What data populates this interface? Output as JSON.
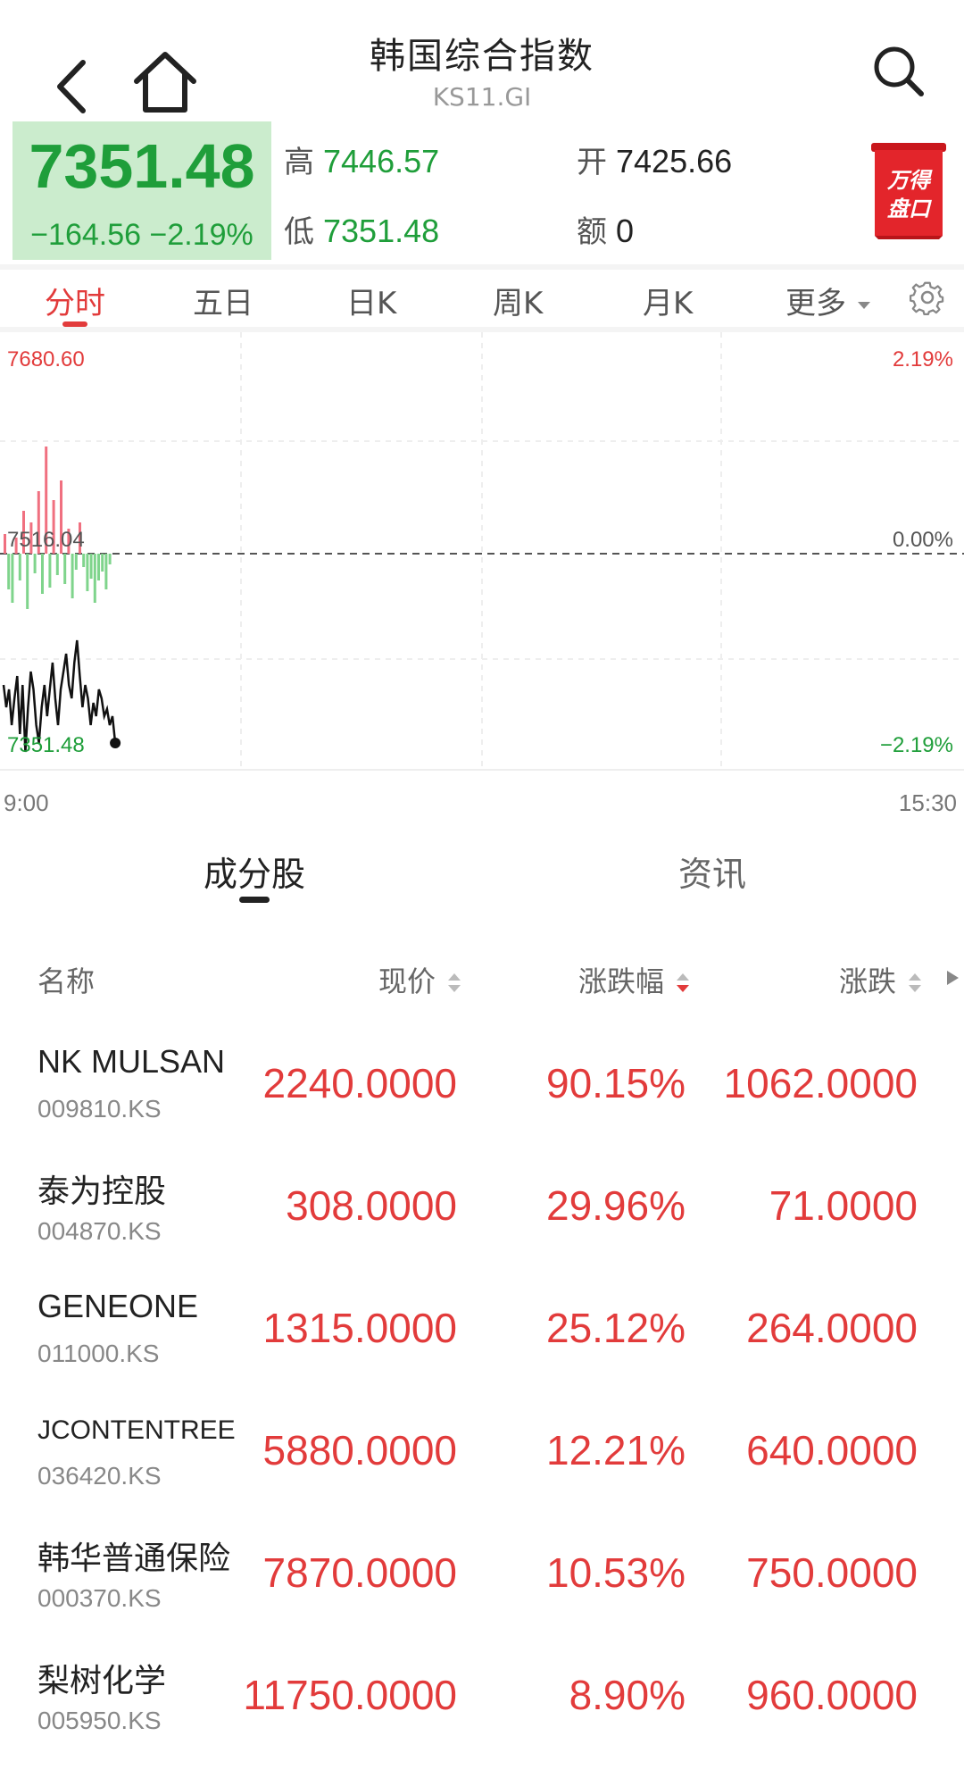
{
  "header": {
    "title": "韩国综合指数",
    "subtitle": "KS11.GI"
  },
  "quote": {
    "price": "7351.48",
    "change": "−164.56",
    "change_pct": "−2.19%",
    "high_label": "高",
    "high_value": "7446.57",
    "low_label": "低",
    "low_value": "7351.48",
    "open_label": "开",
    "open_value": "7425.66",
    "amount_label": "额",
    "amount_value": "0",
    "badge_line1": "万得",
    "badge_line2": "盘口"
  },
  "tabs": [
    "分时",
    "五日",
    "日K",
    "周K",
    "月K",
    "更多"
  ],
  "chart": {
    "y_max_label": "7680.60",
    "y_mid_label": "7516.04",
    "y_min_label": "7351.48",
    "pct_max_label": "2.19%",
    "pct_mid_label": "0.00%",
    "pct_min_label": "−2.19%",
    "time_start": "9:00",
    "time_end": "15:30",
    "colors": {
      "up": "#f07080",
      "down": "#7fd48c",
      "line": "#111111"
    }
  },
  "section_tabs": [
    "成分股",
    "资讯"
  ],
  "table": {
    "headers": [
      "名称",
      "现价",
      "涨跌幅",
      "涨跌"
    ],
    "rows": [
      {
        "name": "NK MULSAN",
        "code": "009810.KS",
        "price": "2240.0000",
        "pct": "90.15%",
        "change": "1062.0000"
      },
      {
        "name": "泰为控股",
        "code": "004870.KS",
        "price": "308.0000",
        "pct": "29.96%",
        "change": "71.0000"
      },
      {
        "name": "GENEONE",
        "code": "011000.KS",
        "price": "1315.0000",
        "pct": "25.12%",
        "change": "264.0000"
      },
      {
        "name": "JCONTENTREE",
        "code": "036420.KS",
        "price": "5880.0000",
        "pct": "12.21%",
        "change": "640.0000"
      },
      {
        "name": "韩华普通保险",
        "code": "000370.KS",
        "price": "7870.0000",
        "pct": "10.53%",
        "change": "750.0000"
      },
      {
        "name": "梨树化学",
        "code": "005950.KS",
        "price": "11750.0000",
        "pct": "8.90%",
        "change": "960.0000"
      }
    ]
  }
}
